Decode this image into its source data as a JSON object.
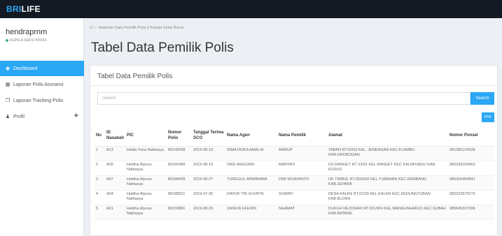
{
  "app": {
    "brand_prefix": "BRI",
    "brand_suffix": "LIFE"
  },
  "user": {
    "name": "hendraprnm",
    "role": "KEPALA SEKSI BISNIS"
  },
  "sidebar": {
    "items": [
      {
        "label": "Dashboard",
        "icon": "dashboard-icon"
      },
      {
        "label": "Laporan Polis Asuransi",
        "icon": "calendar-icon"
      },
      {
        "label": "Laporan Tracking Polis",
        "icon": "copy-icon"
      },
      {
        "label": "Profil",
        "icon": "user-icon"
      }
    ],
    "expand_glyph": "+"
  },
  "breadcrumb": {
    "text": "Halaman Data Pemilik Polis || Kepala Seksi Bisnis"
  },
  "page": {
    "title": "Tabel Data Pemilik Polis"
  },
  "panel": {
    "title": "Tabel Data Pemilik Polis"
  },
  "search": {
    "placeholder": "Search",
    "value": "",
    "button_label": "Search"
  },
  "pdf": {
    "label": "PDF"
  },
  "table": {
    "headers": [
      "No",
      "ID Nasabah",
      "PIC",
      "Nomor Polis",
      "Tanggal Terima SCO",
      "Nama Agen",
      "Nama Pemilik",
      "Alamat",
      "Nomor Ponsel"
    ],
    "rows": [
      [
        "1",
        "A13",
        "Helda Yona Nathasya",
        "80148358",
        "2019-08-19",
        "IRMA RISKA AMALIA",
        "MARUP",
        "TABAN RT.02/03 KEL. JENENGAN KEC.KLAMBU KAB.GROBOGAN",
        "081385124328"
      ],
      [
        "2",
        "A09",
        "Heldha Alyona Nathasya",
        "80165486",
        "2019-08-19",
        "ISKE ANGGANI",
        "MARYATI",
        "DS RANGET RT 03/01 KEL RANGET KEC KALIWUNGU KAB. KUDUS",
        "085338160463"
      ],
      [
        "3",
        "A07",
        "Heldha Alyona Nathasya",
        "80188439",
        "2019-08-27",
        "TUNGGUL ARWIBAWA",
        "DWI WIJAYANTO",
        "DK TIMBUL RT.003/002 KEL.TUBANAN KEC.KEMBANG KAB.JEPARA",
        "085325450841"
      ],
      [
        "4",
        "A04",
        "Heldha Alyona Nathasya",
        "80188521",
        "2019-07-30",
        "DAYUK TRI ULFATIN",
        "SUWATI",
        "DESA KALEN RT.01/03 KEL.KALEN KEC.KEDUNGTUBAN KAB.BLORA",
        "082322670270"
      ],
      [
        "5",
        "A01",
        "Heldha Alyona Nathasya",
        "80150881",
        "2019-08-29",
        "ZAINUR EFENDI",
        "NGAMAT",
        "DUKUH REJOSARI RT.001/004 KEL.MANGUNHARJO KEC.SUBAH KAB.BATANG",
        "085845327606"
      ]
    ]
  },
  "colors": {
    "accent": "#2aa7f5",
    "topbar": "#141a24",
    "status_dot": "#3cb878"
  }
}
